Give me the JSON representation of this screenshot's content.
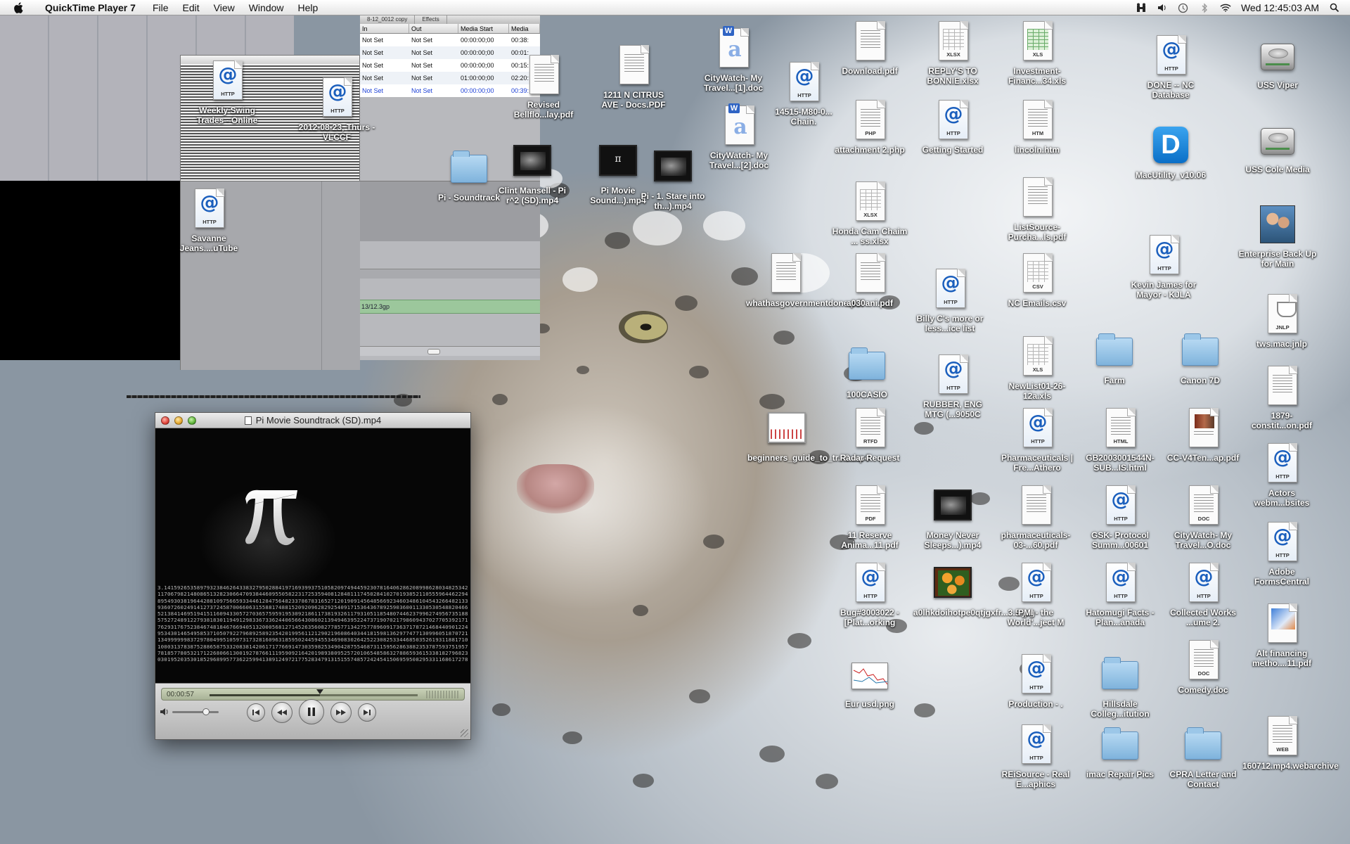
{
  "menubar": {
    "app_name": "QuickTime Player 7",
    "menus": [
      "File",
      "Edit",
      "View",
      "Window",
      "Help"
    ],
    "clock": "Wed 12:45:03 AM",
    "extras": [
      "user-icon",
      "volume-icon",
      "time-machine-icon",
      "bluetooth-icon",
      "wifi-icon",
      "spotlight-icon"
    ]
  },
  "media_window": {
    "tabs": [
      "8-12_0012 copy",
      "Effects"
    ],
    "columns": {
      "in": "In",
      "out": "Out",
      "start": "Media Start",
      "end": "Media"
    },
    "rows": [
      {
        "in": "Not Set",
        "out": "Not Set",
        "start": "00:00:00;00",
        "end": "00:38:"
      },
      {
        "in": "Not Set",
        "out": "Not Set",
        "start": "00:00:00;00",
        "end": "00:01:"
      },
      {
        "in": "Not Set",
        "out": "Not Set",
        "start": "00:00:00;00",
        "end": "00:15:"
      },
      {
        "in": "Not Set",
        "out": "Not Set",
        "start": "01:00:00;00",
        "end": "02:20:"
      },
      {
        "in": "Not Set",
        "out": "Not Set",
        "start": "00:00:00;00",
        "end": "00:39:"
      }
    ],
    "clip_label": "13/12.3gp"
  },
  "player": {
    "title": "Pi Movie Soundtrack (SD).mp4",
    "time": "00:00:57",
    "progress": 0.53,
    "volume": 0.72,
    "pi_digits": "3.14159265358979323846264338327950288419716939937510582097494459230781640628620899862803482534211706798214808651328230664709384460955058223172535940812848111745028410270193852110555964462294895493038196442881097566593344612847564823378678316527120190914564856692346034861045432664821339360726024914127372458700660631558817488152092096282925409171536436789259036001133053054882046652138414695194151160943305727036575959195309218611738193261179310511854807446237996274956735188575272489122793818301194912983367336244065664308602139494639522473719070217986094370277053921717629317675238467481846766940513200056812714526356082778577134275778960917363717872146844090122495343014654958537105079227968925892354201995611212902196086403441815981362977477130996051870721134999999837297804995105973173281609631859502445945534690830264252230825334468503526193118817101000313783875288658753320838142061717766914730359825349042875546873115956286388235378759375195778185778053217122680661300192787661119590921642019893809525720106548586327886593615338182796823030195203530185296899577362259941389124972177528347913151557485724245415069595082953311686172785588907509838175463746493931925506040092770167113900984882401285836160356370766010471018194295559619894676783744944825537977472684710404753464620804668425906949129331367702898915210475216205696602405803815019351125338243003558764024749647326391419927260426992279678235478163600934172164121992458631503028618297455570674983850549458858692699569092721079750930295532116534498720275596023648066549911988183479775356636980742654252786255181841757467289097777279380008164706001614524919217321721477235014144197356854816136115735255213347574184946843852332390739414333454776241686251898356948556209921922218427255025425688767179049460165346680498862723279178608578438382796797668145410095388378636095068006422512520511739298489608412848862694560424196528502221066118630674427862203919494504712371378696095636437191728746776465757396241389086583264599581339047802759009946576407895126946839835259570982582262052248940772671947826848260147699090264013639443745530506820349625245174939965143142980919065925093722169646151570985838741059788595977297549893016175392846813826868386894277415599185592524595395943104997252468084598727364469584865383673622262609912460805124388439045124413654976278079771569143599770012961608944169486855584840635342207222582848864815845602850601684273945226746767889525213852254995466672782398645659611635488623057745649803559363456817432411251507606947945109659609402522887971089314566913686722874894056010150330861792868092087476091782493858900971490967598526136554978189312978482168299894872265880485756401427047755513237964145152374623436454285844479526586782105114135473573952311342716610213596953623144295248493718711014576540359027993440374200731057853906219838744780847848968332144571386875194350643021845319104848100537061468067491927819119793995206141966342875444064374512371819217999839101591956181467514269123974894090718649423196"
  },
  "icons": [
    {
      "label": "Weekly Swing Trades - Online",
      "kind": "http"
    },
    {
      "label": "2012-08-23, Thurs - VLCCF",
      "kind": "http"
    },
    {
      "label": "Savanne Jeans....uTube",
      "kind": "http"
    },
    {
      "label": "Revised Bellflo...lay.pdf",
      "kind": "doc",
      "tag": ""
    },
    {
      "label": "1211 N CITRUS AVE - Docs.PDF",
      "kind": "doc",
      "tag": ""
    },
    {
      "label": "CityWatch- My Travel...[1].doc",
      "kind": "word"
    },
    {
      "label": "14515-M80-0... Chain.",
      "kind": "http"
    },
    {
      "label": "CityWatch- My Travel...[2].doc",
      "kind": "word"
    },
    {
      "label": "Pi - Soundtrack",
      "kind": "folder"
    },
    {
      "label": "Clint Mansell - Pi r^2 (SD).mp4",
      "kind": "video"
    },
    {
      "label": "Pi Movie Sound...).mp4",
      "kind": "video-pi"
    },
    {
      "label": "Pi - 1. Stare into th...).mp4",
      "kind": "video"
    },
    {
      "label": "Download.pdf",
      "kind": "doc",
      "tag": ""
    },
    {
      "label": "REPLY'S TO BONNIE.xlsx",
      "kind": "sheet",
      "tag": "XLSX"
    },
    {
      "label": "Investment-Financ...34.xls",
      "kind": "sheet-green",
      "tag": "XLS"
    },
    {
      "label": "attachment 2.php",
      "kind": "doc",
      "tag": "PHP"
    },
    {
      "label": "Getting Started",
      "kind": "http"
    },
    {
      "label": "lincoln.htm",
      "kind": "doc",
      "tag": "HTM"
    },
    {
      "label": "Honda Cam Chaim ... ss.xlsx",
      "kind": "sheet",
      "tag": "XLSX"
    },
    {
      "label": "ListSource-Purcha...ls.pdf",
      "kind": "doc",
      "tag": ""
    },
    {
      "label": "whathasgovernmentdone.pdf",
      "kind": "doc",
      "tag": ""
    },
    {
      "label": "a030ani.pdf",
      "kind": "doc",
      "tag": ""
    },
    {
      "label": "Billy C's more or less...ice list",
      "kind": "http"
    },
    {
      "label": "NC Emails.csv",
      "kind": "sheet",
      "tag": "CSV"
    },
    {
      "label": "100CASIO",
      "kind": "folder"
    },
    {
      "label": "RUBBER, ENG MTG (...9050C",
      "kind": "http"
    },
    {
      "label": "NewList01-26-12a.xls",
      "kind": "sheet",
      "tag": "XLS"
    },
    {
      "label": "beginners_guide_to_tr...0.mp4",
      "kind": "video-white"
    },
    {
      "label": "Radar Request",
      "kind": "doc",
      "tag": "RTFD"
    },
    {
      "label": "Pharmaceuticals | Fre...Athero",
      "kind": "http"
    },
    {
      "label": "GB2003001544N-SUB...IS.html",
      "kind": "doc",
      "tag": "HTML"
    },
    {
      "label": "11 Reserve Anima...11.pdf",
      "kind": "doc",
      "tag": "PDF"
    },
    {
      "label": "Money Never Sleeps...).mp4",
      "kind": "video"
    },
    {
      "label": "pharmaceuticals-03-...60.pdf",
      "kind": "doc",
      "tag": ""
    },
    {
      "label": "GSK- Protocol Summ...00601",
      "kind": "http"
    },
    {
      "label": "Bug#3003022 - [Plat...orking",
      "kind": "http"
    },
    {
      "label": "a0lhkdoihotpe0qtjgxfr...3.5.jpg",
      "kind": "video-orange"
    },
    {
      "label": "PMI - the World'...ject M",
      "kind": "http"
    },
    {
      "label": "Hatomugi Facts - Plan...anada",
      "kind": "http"
    },
    {
      "label": "Eur usd.png",
      "kind": "graph"
    },
    {
      "label": "Production - .",
      "kind": "http"
    },
    {
      "label": "Hillsdale Colleg...itution",
      "kind": "folder"
    },
    {
      "label": "REiSource - Real E...aphics",
      "kind": "http"
    },
    {
      "label": "imac Repair Pics",
      "kind": "folder"
    },
    {
      "label": "CPRA Letter and Contact",
      "kind": "folder"
    },
    {
      "label": "DONE -- NC Database",
      "kind": "http"
    },
    {
      "label": "MacUtility_v10.06",
      "kind": "dlogo"
    },
    {
      "label": "Kevin James for Mayor - KJLA",
      "kind": "http"
    },
    {
      "label": "Farm",
      "kind": "folder"
    },
    {
      "label": "Canon 7D",
      "kind": "folder"
    },
    {
      "label": "CC-V4Ten...ap.pdf",
      "kind": "doc-color"
    },
    {
      "label": "CityWatch- My Travel...O.doc",
      "kind": "doc",
      "tag": "DOC"
    },
    {
      "label": "Collected Works ...ume 2.",
      "kind": "http"
    },
    {
      "label": "Comedy.doc",
      "kind": "doc",
      "tag": "DOC"
    },
    {
      "label": "USS Viper",
      "kind": "drive"
    },
    {
      "label": "USS Cole Media",
      "kind": "drive"
    },
    {
      "label": "Enterprise Back Up for Main",
      "kind": "photo"
    },
    {
      "label": "tws.mac.jnlp",
      "kind": "jnlp",
      "tag": "JNLP"
    },
    {
      "label": "1879-constit...on.pdf",
      "kind": "doc",
      "tag": ""
    },
    {
      "label": "Actors webm...bsites",
      "kind": "http"
    },
    {
      "label": "Adobe FormsCentral",
      "kind": "http"
    },
    {
      "label": "Alt financing metho....11.pdf",
      "kind": "doc-blue"
    },
    {
      "label": "160712.mp4.webarchive",
      "kind": "doc",
      "tag": "WEB"
    }
  ]
}
